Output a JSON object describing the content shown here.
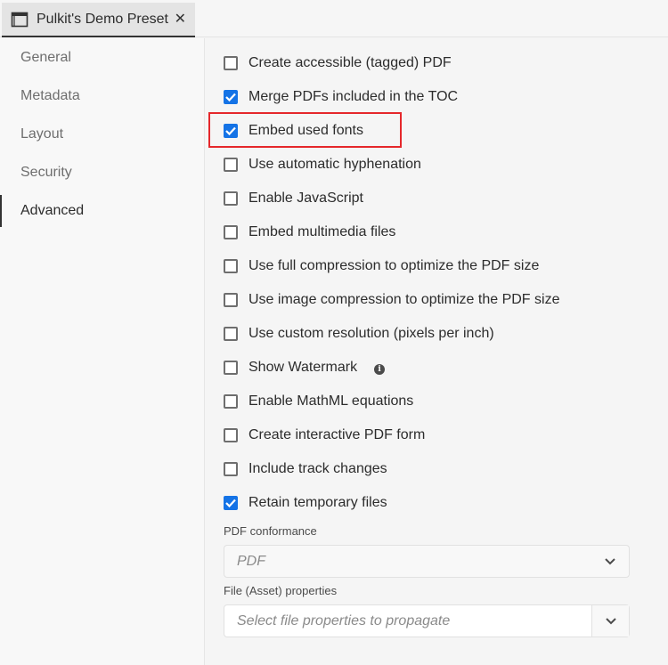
{
  "tab": {
    "title": "Pulkit's Demo Preset",
    "close": "✕"
  },
  "sidebar": {
    "items": [
      {
        "label": "General",
        "active": false
      },
      {
        "label": "Metadata",
        "active": false
      },
      {
        "label": "Layout",
        "active": false
      },
      {
        "label": "Security",
        "active": false
      },
      {
        "label": "Advanced",
        "active": true
      }
    ]
  },
  "options": [
    {
      "label": "Create accessible (tagged) PDF",
      "checked": false
    },
    {
      "label": "Merge PDFs included in the TOC",
      "checked": true
    },
    {
      "label": "Embed used fonts",
      "checked": true
    },
    {
      "label": "Use automatic hyphenation",
      "checked": false
    },
    {
      "label": "Enable JavaScript",
      "checked": false
    },
    {
      "label": "Embed multimedia files",
      "checked": false
    },
    {
      "label": "Use full compression to optimize the PDF size",
      "checked": false
    },
    {
      "label": "Use image compression to optimize the PDF size",
      "checked": false
    },
    {
      "label": "Use custom resolution (pixels per inch)",
      "checked": false
    },
    {
      "label": "Show Watermark",
      "checked": false,
      "info": true
    },
    {
      "label": "Enable MathML equations",
      "checked": false
    },
    {
      "label": "Create interactive PDF form",
      "checked": false
    },
    {
      "label": "Include track changes",
      "checked": false
    },
    {
      "label": "Retain temporary files",
      "checked": true
    }
  ],
  "conformance": {
    "label": "PDF conformance",
    "value": "PDF"
  },
  "asset": {
    "label": "File (Asset) properties",
    "placeholder": "Select file properties to propagate"
  },
  "colors": {
    "accent": "#1473e6",
    "highlight": "#e5272b"
  }
}
